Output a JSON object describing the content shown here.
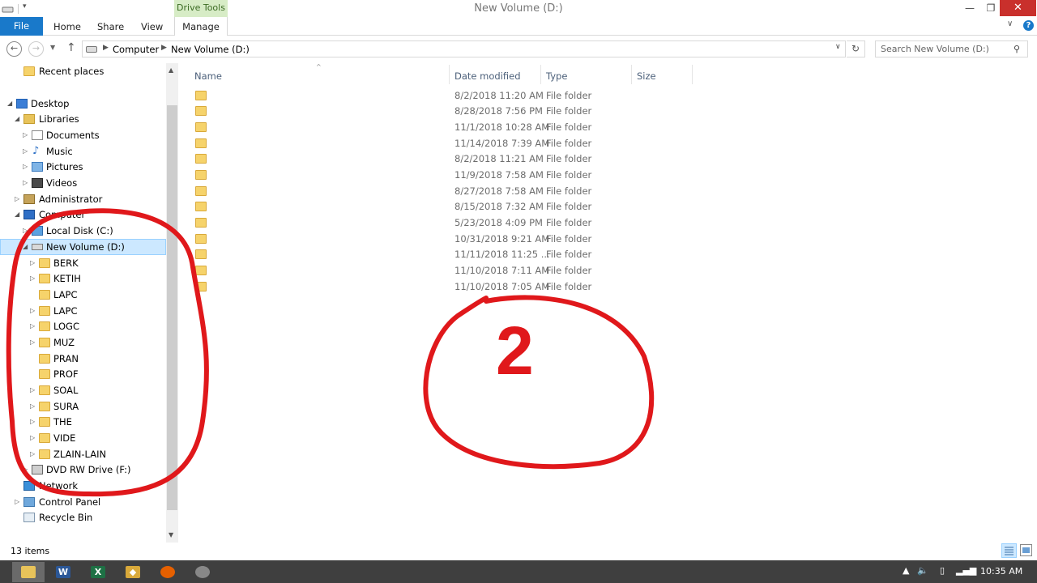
{
  "window": {
    "title": "New Volume (D:)",
    "contextual_tab": "Drive Tools",
    "min_icon": "minimize-icon",
    "max_icon": "maximize-icon",
    "close_icon": "close-icon"
  },
  "ribbon": {
    "tabs": [
      {
        "label": "File"
      },
      {
        "label": "Home"
      },
      {
        "label": "Share"
      },
      {
        "label": "View"
      },
      {
        "label": "Manage"
      }
    ],
    "accent": "#1979ca"
  },
  "address": {
    "crumbs": [
      "Computer",
      "New Volume (D:)"
    ],
    "search_placeholder": "Search New Volume (D:)"
  },
  "navpane": {
    "items": [
      {
        "label": "Recent places"
      },
      {
        "label": "Desktop"
      },
      {
        "label": "Libraries"
      },
      {
        "label": "Documents"
      },
      {
        "label": "Music"
      },
      {
        "label": "Pictures"
      },
      {
        "label": "Videos"
      },
      {
        "label": "Administrator"
      },
      {
        "label": "Computer"
      },
      {
        "label": "Local Disk (C:)"
      },
      {
        "label": "New Volume (D:)"
      },
      {
        "label": "BERK"
      },
      {
        "label": "KETIH"
      },
      {
        "label": "LAPC"
      },
      {
        "label": "LAPC"
      },
      {
        "label": "LOGC"
      },
      {
        "label": "MUZ"
      },
      {
        "label": "PRAN"
      },
      {
        "label": "PROF"
      },
      {
        "label": "SOAL"
      },
      {
        "label": "SURA"
      },
      {
        "label": "THE"
      },
      {
        "label": "VIDE"
      },
      {
        "label": "ZLAIN-LAIN"
      },
      {
        "label": "DVD RW Drive (F:)"
      },
      {
        "label": "Network"
      },
      {
        "label": "Control Panel"
      },
      {
        "label": "Recycle Bin"
      }
    ]
  },
  "columns": {
    "name": "Name",
    "date": "Date modified",
    "type": "Type",
    "size": "Size"
  },
  "files": [
    {
      "date": "8/2/2018 11:20 AM",
      "type": "File folder"
    },
    {
      "date": "8/28/2018 7:56 PM",
      "type": "File folder"
    },
    {
      "date": "11/1/2018 10:28 AM",
      "type": "File folder"
    },
    {
      "date": "11/14/2018 7:39 AM",
      "type": "File folder"
    },
    {
      "date": "8/2/2018 11:21 AM",
      "type": "File folder"
    },
    {
      "date": "11/9/2018 7:58 AM",
      "type": "File folder"
    },
    {
      "date": "8/27/2018 7:58 AM",
      "type": "File folder"
    },
    {
      "date": "8/15/2018 7:32 AM",
      "type": "File folder"
    },
    {
      "date": "5/23/2018 4:09 PM",
      "type": "File folder"
    },
    {
      "date": "10/31/2018 9:21 AM",
      "type": "File folder"
    },
    {
      "date": "11/11/2018 11:25 ...",
      "type": "File folder"
    },
    {
      "date": "11/10/2018 7:11 AM",
      "type": "File folder"
    },
    {
      "date": "11/10/2018 7:05 AM",
      "type": "File folder"
    }
  ],
  "status": {
    "item_count": "13 items"
  },
  "taskbar": {
    "apps": [
      "file-explorer-icon",
      "word-icon",
      "excel-icon",
      "app-icon",
      "firefox-icon",
      "chrome-icon"
    ],
    "clock": "10:35 AM"
  },
  "annotation": {
    "label": "2",
    "color": "#e0181b"
  }
}
